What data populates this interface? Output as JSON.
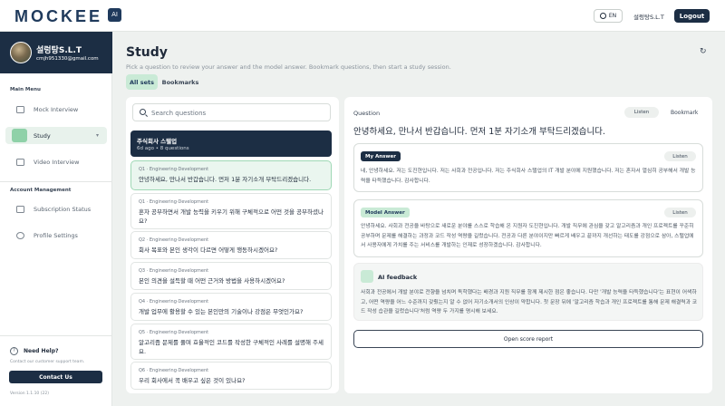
{
  "header": {
    "logo": "MOCKEE",
    "logo_badge": "AI",
    "language": "EN",
    "user_name": "설렁탕S.L.T",
    "logout_label": "Logout"
  },
  "sidebar": {
    "profile": {
      "name": "설렁탕S.L.T",
      "email": "cmjh951330@gmail.com"
    },
    "main_menu_label": "Main Menu",
    "main_items": [
      {
        "label": "Mock Interview",
        "icon": "mock-interview-icon"
      },
      {
        "label": "Study",
        "icon": "study-icon",
        "chevron": "▾"
      },
      {
        "label": "Video Interview",
        "icon": "video-icon"
      }
    ],
    "account_label": "Account Management",
    "account_items": [
      {
        "label": "Subscription Status",
        "icon": "monitor-icon"
      },
      {
        "label": "Profile Settings",
        "icon": "user-icon"
      }
    ],
    "help": {
      "icon_glyph": "?",
      "title": "Need Help?",
      "subtitle": "Contact our customer support team.",
      "button": "Contact Us"
    },
    "version": "Version 1.1.10 (22)"
  },
  "main": {
    "title": "Study",
    "subtitle": "Pick a question to review your answer and the model answer. Bookmark questions, then start a study session.",
    "refresh_glyph": "↻",
    "tabs": [
      {
        "label": "All sets"
      },
      {
        "label": "Bookmarks"
      }
    ]
  },
  "question_list": {
    "search_placeholder": "Search questions",
    "set": {
      "title": "주식회사 스탤업",
      "meta": "6d ago • 8 questions"
    },
    "items": [
      {
        "meta": "Q1 · Engineering·Development",
        "text": "안녕하세요, 만나서 반갑습니다. 먼저 1분 자기소개 부탁드리겠습니다."
      },
      {
        "meta": "Q1 · Engineering·Development",
        "text": "혼자 공부하면서 개발 능력을 키우기 위해 구체적으로 어떤 것을 공부하셨나요?"
      },
      {
        "meta": "Q2 · Engineering·Development",
        "text": "회사 목표와 본인 생각이 다르면 어떻게 행동하시겠어요?"
      },
      {
        "meta": "Q3 · Engineering·Development",
        "text": "본인 의견을 설득할 때 어떤 근거와 방법을 사용하시겠어요?"
      },
      {
        "meta": "Q4 · Engineering·Development",
        "text": "개발 업무에 활용할 수 있는 본인만의 기술이나 강점은 무엇인가요?"
      },
      {
        "meta": "Q5 · Engineering·Development",
        "text": "알고리즘 문제를 풀며 효율적인 코드를 작성한 구체적인 사례를 설명해 주세요."
      },
      {
        "meta": "Q6 · Engineering·Development",
        "text": "우리 회사에서 꼭 배우고 싶은 것이 있나요?"
      }
    ]
  },
  "detail": {
    "label": "Question",
    "listen_label": "Listen",
    "bookmark_label": "Bookmark",
    "question": "안녕하세요, 만나서 반갑습니다. 먼저 1분 자기소개 부탁드리겠습니다.",
    "my_answer": {
      "label": "My Answer",
      "listen": "Listen",
      "text": "네, 안녕하세요. 저는 도진현입니다. 저는 사회과 전공입니다. 저는 주식회사 스탤업의 IT 개발 분야에 지원했습니다. 저는 혼자서 열심히 공부해서 개발 능력을 타득했습니다. 감사합니다."
    },
    "model_answer": {
      "label": "Model Answer",
      "listen": "Listen",
      "text": "안녕하세요. 사회과 전공을 바탕으로 새로운 분야를 스스로 학습해 온 지원자 도진현입니다. 개발 직무에 관심을 갖고 알고리즘과 개인 프로젝트를 꾸준히 공부하며 문제를 해결하는 과정과 코드 작성 역량을 길렀습니다. 전공과 다른 분야이지만 빠르게 배우고 끝까지 개선하는 태도를 강점으로 삼아, 스탤업에서 사용자에게 가치를 주는 서비스를 개발하는 인재로 성장하겠습니다. 감사합니다."
    },
    "ai_feedback": {
      "title": "AI feedback",
      "text": "사회과 전공에서 개발 분야로 전향을 넘치며 독학했다는 배경과 지원 직무를 함께 제시한 점은 좋습니다. 다만 '개발 능력을 타득했습니다'는 표현이 어색하고, 어떤 역량을 어느 수준까지 갖췄는지 알 수 없어 자기소개서의 인상이 약합니다. 첫 문장 뒤에 '알고리즘 학습과 개인 프로젝트를 통해 문제 해결력과 코드 작성 습관을 길렀습니다'처럼 역량 두 가지를 명시해 보세요."
    },
    "score_button": "Open score report"
  },
  "colors": {
    "navy": "#1c2e44",
    "mint": "#c9ead6",
    "mint_strong": "#8fd1a8",
    "background": "#eef1ef"
  }
}
